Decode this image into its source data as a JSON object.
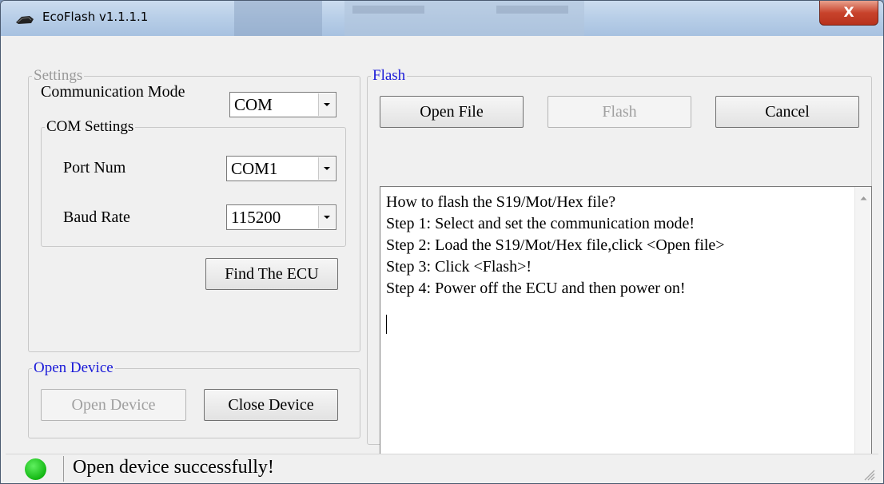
{
  "window": {
    "title": "EcoFlash v1.1.1.1",
    "close_glyph": "X"
  },
  "settings": {
    "legend": "Settings",
    "comm_mode_label": "Communication Mode",
    "comm_mode_value": "COM",
    "com_settings": {
      "legend": "COM Settings",
      "port_label": "Port Num",
      "port_value": "COM1",
      "baud_label": "Baud Rate",
      "baud_value": "115200"
    },
    "find_ecu_button": "Find The ECU"
  },
  "open_device": {
    "legend": "Open Device",
    "open_button": "Open Device",
    "close_button": "Close Device"
  },
  "flash": {
    "legend": "Flash",
    "open_file_button": "Open File",
    "flash_button": "Flash",
    "cancel_button": "Cancel",
    "log_lines": [
      "How to flash the S19/Mot/Hex file?",
      "Step 1: Select and set the communication mode!",
      "Step 2: Load the S19/Mot/Hex file,click <Open file>",
      "Step 3: Click <Flash>!",
      "Step 4: Power off the ECU and then power on!"
    ]
  },
  "status": {
    "text": "Open device successfully!",
    "led_color": "#22c322"
  },
  "icons": [
    "app-icon",
    "close-icon",
    "dropdown-arrow-icon",
    "scroll-up-icon",
    "scroll-down-icon",
    "status-led-icon",
    "resize-grip-icon"
  ]
}
